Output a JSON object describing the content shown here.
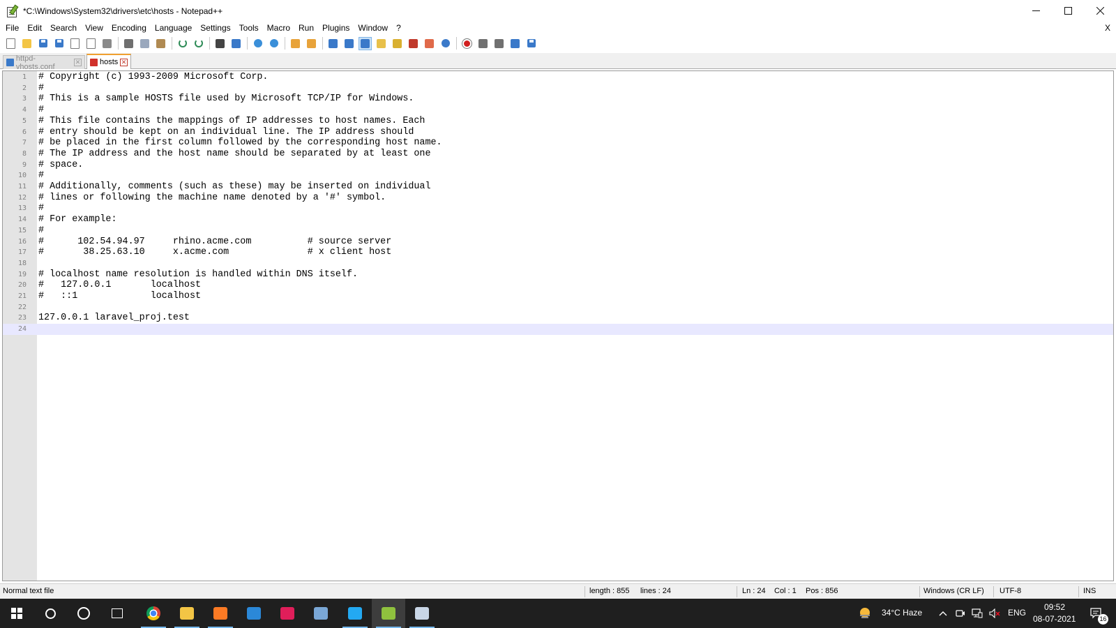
{
  "window": {
    "title": "*C:\\Windows\\System32\\drivers\\etc\\hosts - Notepad++",
    "controls": {
      "minimize": "—",
      "close": "✕"
    }
  },
  "menu": {
    "items": [
      "File",
      "Edit",
      "Search",
      "View",
      "Encoding",
      "Language",
      "Settings",
      "Tools",
      "Macro",
      "Run",
      "Plugins",
      "Window",
      "?"
    ],
    "close_doc": "X"
  },
  "toolbar": {
    "buttons": [
      {
        "icon": "new-file-icon",
        "color": "#ffffff"
      },
      {
        "icon": "open-file-icon",
        "color": "#f3c545"
      },
      {
        "icon": "save-icon",
        "color": "#3a79c9"
      },
      {
        "icon": "save-all-icon",
        "color": "#3a79c9"
      },
      {
        "icon": "close-icon",
        "color": "#d9a441"
      },
      {
        "icon": "close-all-icon",
        "color": "#d9a441"
      },
      {
        "icon": "print-icon",
        "color": "#8a8a8a"
      },
      {
        "sep": true
      },
      {
        "icon": "cut-icon",
        "color": "#6f6f6f"
      },
      {
        "icon": "copy-icon",
        "color": "#9aa8bd"
      },
      {
        "icon": "paste-icon",
        "color": "#b08a52"
      },
      {
        "sep": true
      },
      {
        "icon": "undo-icon",
        "color": "#2e8b57"
      },
      {
        "icon": "redo-icon",
        "color": "#2e8b57"
      },
      {
        "sep": true
      },
      {
        "icon": "find-icon",
        "color": "#444444"
      },
      {
        "icon": "replace-icon",
        "color": "#3a79c9"
      },
      {
        "sep": true
      },
      {
        "icon": "zoom-in-icon",
        "color": "#3a8fd9"
      },
      {
        "icon": "zoom-out-icon",
        "color": "#3a8fd9"
      },
      {
        "sep": true
      },
      {
        "icon": "sync-vertical-icon",
        "color": "#e8a33a"
      },
      {
        "icon": "sync-horizontal-icon",
        "color": "#e8a33a"
      },
      {
        "sep": true
      },
      {
        "icon": "word-wrap-icon",
        "color": "#3a79c9"
      },
      {
        "icon": "show-all-characters-icon",
        "color": "#3a79c9"
      },
      {
        "icon": "indent-guide-icon",
        "color": "#3a79c9",
        "active": true
      },
      {
        "icon": "user-defined-language-icon",
        "color": "#e8c04a"
      },
      {
        "icon": "document-map-icon",
        "color": "#d9b030"
      },
      {
        "icon": "function-list-icon",
        "color": "#c0392b"
      },
      {
        "icon": "folder-as-workspace-icon",
        "color": "#e06a4a"
      },
      {
        "icon": "monitoring-icon",
        "color": "#3a79c9"
      },
      {
        "sep": true
      },
      {
        "icon": "record-macro-icon",
        "color": "#d11f1f"
      },
      {
        "icon": "stop-macro-icon",
        "color": "#707070"
      },
      {
        "icon": "play-macro-icon",
        "color": "#707070"
      },
      {
        "icon": "run-macro-multiple-icon",
        "color": "#3a79c9"
      },
      {
        "icon": "save-macro-icon",
        "color": "#707070"
      }
    ]
  },
  "tabs": [
    {
      "label": "httpd-vhosts.conf",
      "active": false,
      "icon_color": "#3a79c9"
    },
    {
      "label": "hosts",
      "active": true,
      "icon_color": "#d1312b"
    }
  ],
  "editor": {
    "current_line": 24,
    "lines": [
      "# Copyright (c) 1993-2009 Microsoft Corp.",
      "#",
      "# This is a sample HOSTS file used by Microsoft TCP/IP for Windows.",
      "#",
      "# This file contains the mappings of IP addresses to host names. Each",
      "# entry should be kept on an individual line. The IP address should",
      "# be placed in the first column followed by the corresponding host name.",
      "# The IP address and the host name should be separated by at least one",
      "# space.",
      "#",
      "# Additionally, comments (such as these) may be inserted on individual",
      "# lines or following the machine name denoted by a '#' symbol.",
      "#",
      "# For example:",
      "#",
      "#      102.54.94.97     rhino.acme.com          # source server",
      "#       38.25.63.10     x.acme.com              # x client host",
      "",
      "# localhost name resolution is handled within DNS itself.",
      "#   127.0.0.1       localhost",
      "#   ::1             localhost",
      "",
      "127.0.0.1 laravel_proj.test",
      ""
    ]
  },
  "status": {
    "file_type": "Normal text file",
    "length": "length : 855",
    "lines": "lines : 24",
    "ln": "Ln : 24",
    "col": "Col : 1",
    "pos": "Pos : 856",
    "eol": "Windows (CR LF)",
    "encoding": "UTF-8",
    "mode": "INS"
  },
  "taskbar": {
    "apps": [
      {
        "name": "start-button",
        "icon": "windows-logo-icon",
        "color": "#ffffff"
      },
      {
        "name": "search-button",
        "icon": "search-icon",
        "color": "#ffffff"
      },
      {
        "name": "cortana-button",
        "icon": "cortana-circle-icon",
        "color": "#ffffff"
      },
      {
        "name": "task-view-button",
        "icon": "task-view-icon",
        "color": "#ffffff"
      },
      {
        "name": "chrome-app",
        "icon": "chrome-icon",
        "color": "#db4437",
        "open": true
      },
      {
        "name": "file-explorer-app",
        "icon": "folder-icon",
        "color": "#f3c545",
        "open": true
      },
      {
        "name": "xampp-app",
        "icon": "xampp-icon",
        "color": "#fb7a24",
        "open": true
      },
      {
        "name": "store-app",
        "icon": "store-icon",
        "color": "#2b88d8"
      },
      {
        "name": "slack-app",
        "icon": "slack-icon",
        "color": "#e01e5a"
      },
      {
        "name": "paint-app",
        "icon": "paint-icon",
        "color": "#7aa7d6"
      },
      {
        "name": "vscode-app",
        "icon": "vscode-icon",
        "color": "#23a9f2",
        "open": true
      },
      {
        "name": "notepadpp-app",
        "icon": "notepadpp-icon",
        "color": "#8fc13e",
        "open": true,
        "focused": true
      },
      {
        "name": "paint-3d-app",
        "icon": "paint-3d-icon",
        "color": "#c9d6e6",
        "open": true
      }
    ],
    "weather": "34°C  Haze",
    "language": "ENG",
    "time": "09:52",
    "date": "08-07-2021",
    "notifications": "16"
  }
}
